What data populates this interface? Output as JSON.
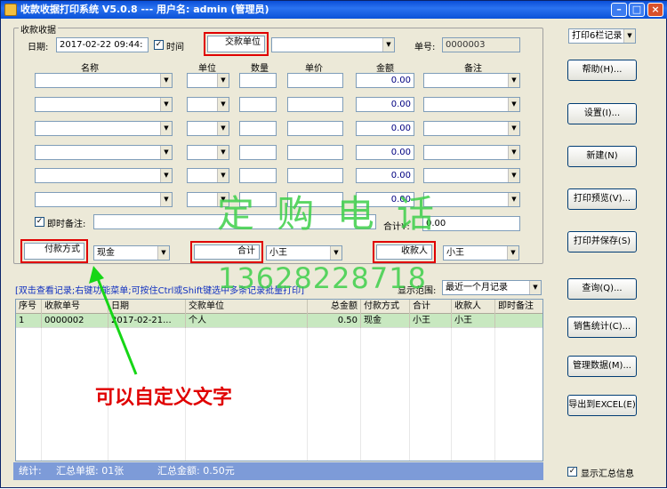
{
  "window": {
    "title": "收款收据打印系统 V5.0.8 --- 用户名: admin (管理员)"
  },
  "receipt": {
    "group_title": "收款收据",
    "date_label": "日期:",
    "date_value": "2017-02-22 09:44:",
    "time_label": "时间",
    "payer_label": "交款单位",
    "number_label": "单号:",
    "number_value": "0000003",
    "columns": [
      "名称",
      "单位",
      "数量",
      "单价",
      "金额",
      "备注"
    ],
    "row_amounts": [
      "0.00",
      "0.00",
      "0.00",
      "0.00",
      "0.00",
      "0.00"
    ],
    "remark_label": "即时备注:",
    "total_label": "合计¥:",
    "total_value": "0.00",
    "payment_method_label": "付款方式",
    "payment_method_value": "现金",
    "total_person_label": "合计",
    "total_person_value": "小王",
    "payee_label": "收款人",
    "payee_value": "小王"
  },
  "print_mode": "打印6栏记录",
  "buttons": {
    "help": "帮助(H)...",
    "settings": "设置(I)...",
    "new": "新建(N)",
    "preview": "打印预览(V)...",
    "print_save": "打印并保存(S)",
    "query": "查询(Q)...",
    "sales_stats": "销售统计(C)...",
    "manage": "管理数据(M)...",
    "export": "导出到EXCEL(E)"
  },
  "records": {
    "hint": "[双击查看记录;右键功能菜单;可按住Ctrl或Shift键选中多条记录批量打印]",
    "range_label": "显示范围:",
    "range_value": "最近一个月记录",
    "headers": [
      "序号",
      "收款单号",
      "日期",
      "交款单位",
      "总金额",
      "付款方式",
      "合计",
      "收款人",
      "即时备注"
    ],
    "rows": [
      [
        "1",
        "0000002",
        "2017-02-21...",
        "个人",
        "0.50",
        "现金",
        "小王",
        "小王",
        ""
      ]
    ]
  },
  "status": {
    "stats_label": "统计:",
    "count_text": "汇总单据: 01张",
    "amount_text": "汇总金额: 0.50元"
  },
  "show_summary_label": "显示汇总信息",
  "watermark": {
    "line1": "定 购 电 话",
    "line2": "13628228718"
  },
  "annotation": "可以自定义文字",
  "colors": {
    "title_bar": "#0a4ed8",
    "status_bar": "#7d9bd8",
    "highlight_red": "#e00000",
    "watermark_green": "#3ed04a"
  }
}
